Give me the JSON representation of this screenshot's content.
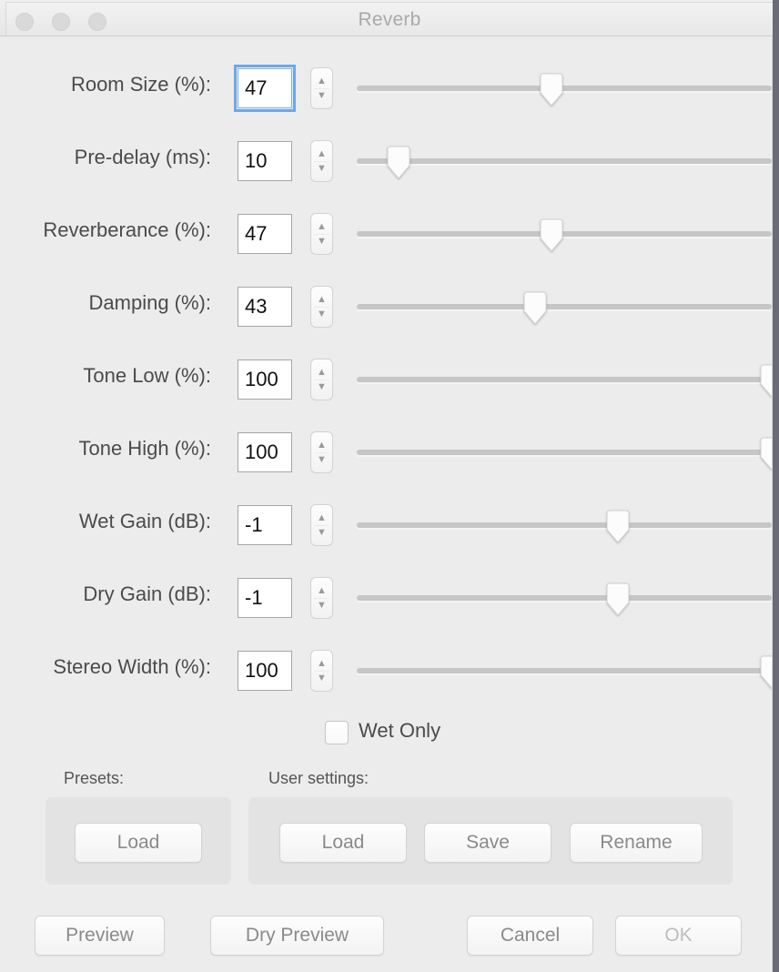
{
  "window": {
    "title": "Reverb",
    "traffic_lights": [
      "close",
      "minimize",
      "maximize"
    ]
  },
  "controls": [
    {
      "label": "Room Size (%):",
      "value": "47",
      "focused": true,
      "slider_pct": 47,
      "min": 0,
      "max": 100
    },
    {
      "label": "Pre-delay (ms):",
      "value": "10",
      "focused": false,
      "slider_pct": 10,
      "min": 0,
      "max": 200
    },
    {
      "label": "Reverberance (%):",
      "value": "47",
      "focused": false,
      "slider_pct": 47,
      "min": 0,
      "max": 100
    },
    {
      "label": "Damping (%):",
      "value": "43",
      "focused": false,
      "slider_pct": 43,
      "min": 0,
      "max": 100
    },
    {
      "label": "Tone Low (%):",
      "value": "100",
      "focused": false,
      "slider_pct": 100,
      "min": 0,
      "max": 100
    },
    {
      "label": "Tone High (%):",
      "value": "100",
      "focused": false,
      "slider_pct": 100,
      "min": 0,
      "max": 100
    },
    {
      "label": "Wet Gain (dB):",
      "value": "-1",
      "focused": false,
      "slider_pct": 63,
      "min": -20,
      "max": 10
    },
    {
      "label": "Dry Gain (dB):",
      "value": "-1",
      "focused": false,
      "slider_pct": 63,
      "min": -20,
      "max": 10
    },
    {
      "label": "Stereo Width (%):",
      "value": "100",
      "focused": false,
      "slider_pct": 100,
      "min": 0,
      "max": 100
    }
  ],
  "wet_only": {
    "label": "Wet Only",
    "checked": false
  },
  "presets": {
    "caption": "Presets:",
    "load_label": "Load"
  },
  "user_settings": {
    "caption": "User settings:",
    "load_label": "Load",
    "save_label": "Save",
    "rename_label": "Rename"
  },
  "footer": {
    "preview_label": "Preview",
    "dry_preview_label": "Dry Preview",
    "cancel_label": "Cancel",
    "ok_label": "OK",
    "ok_dimmed": true
  },
  "colors": {
    "window_bg": "#ececec",
    "title_text": "#a9a9a9",
    "label_text": "#4b4b4b",
    "button_text": "#8a8a8a",
    "focus_ring": "#6ea7e8",
    "slider_track": "#c6c6c6",
    "group_bg": "#e3e3e3"
  },
  "stepper_icons": {
    "up": "chevron-up-icon",
    "down": "chevron-down-icon"
  }
}
